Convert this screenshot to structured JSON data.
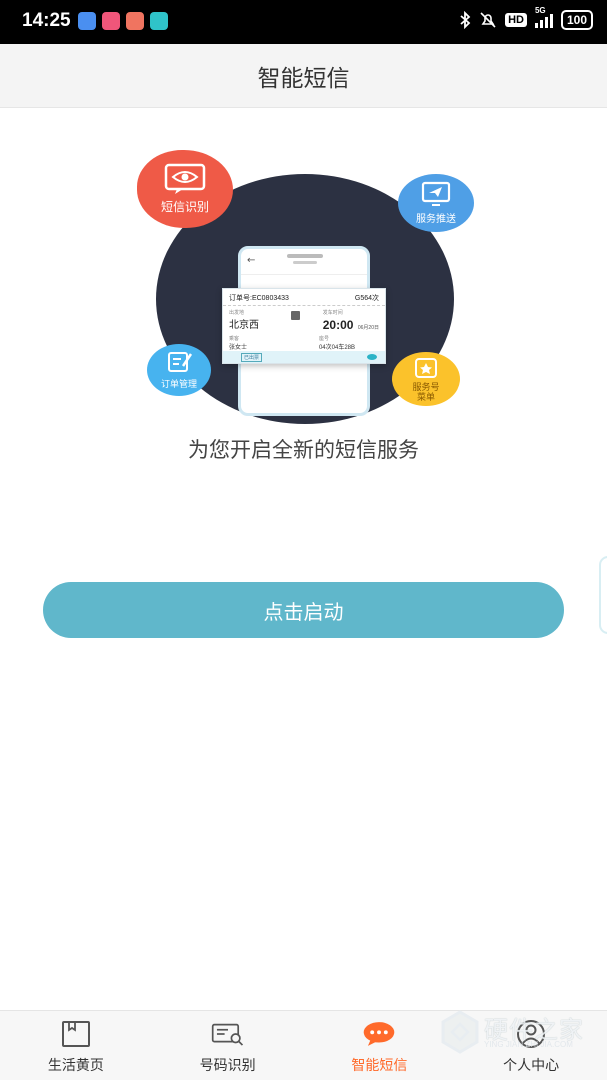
{
  "status_bar": {
    "time": "14:25",
    "network": "5G",
    "hd": "HD",
    "battery": "100"
  },
  "header": {
    "title": "智能短信"
  },
  "illustration": {
    "bubbles": {
      "sms_recognition": "短信识别",
      "service_push": "服务推送",
      "order_management": "订单管理",
      "service_menu": "服务号\n菜单"
    },
    "ticket": {
      "order_no": "订单号:EC0803433",
      "train_no": "G564次",
      "depart_label": "出发地",
      "depart_value": "北京西",
      "time_label": "发车时间",
      "time_value": "20:00",
      "date_value": "06月20日",
      "passenger_label": "乘客",
      "passenger_value": "张女士",
      "seat_label": "座号",
      "seat_value": "04次04车28B",
      "status_tag": "已出票"
    }
  },
  "slogan": "为您开启全新的短信服务",
  "start_button": "点击启动",
  "bottom_nav": {
    "items": [
      {
        "label": "生活黄页",
        "icon": "book-icon",
        "active": false
      },
      {
        "label": "号码识别",
        "icon": "id-card-search-icon",
        "active": false
      },
      {
        "label": "智能短信",
        "icon": "chat-bubble-icon",
        "active": true
      },
      {
        "label": "个人中心",
        "icon": "user-icon",
        "active": false
      }
    ],
    "active_color": "#ff6a2b"
  },
  "watermark": {
    "text": "硬件之家",
    "sub": "YING JIAN ZHI JIA.COM"
  },
  "colors": {
    "accent_button": "#60b7cb",
    "title_bar_bg": "#f4f4f4",
    "dark_blob": "#2c3142"
  }
}
